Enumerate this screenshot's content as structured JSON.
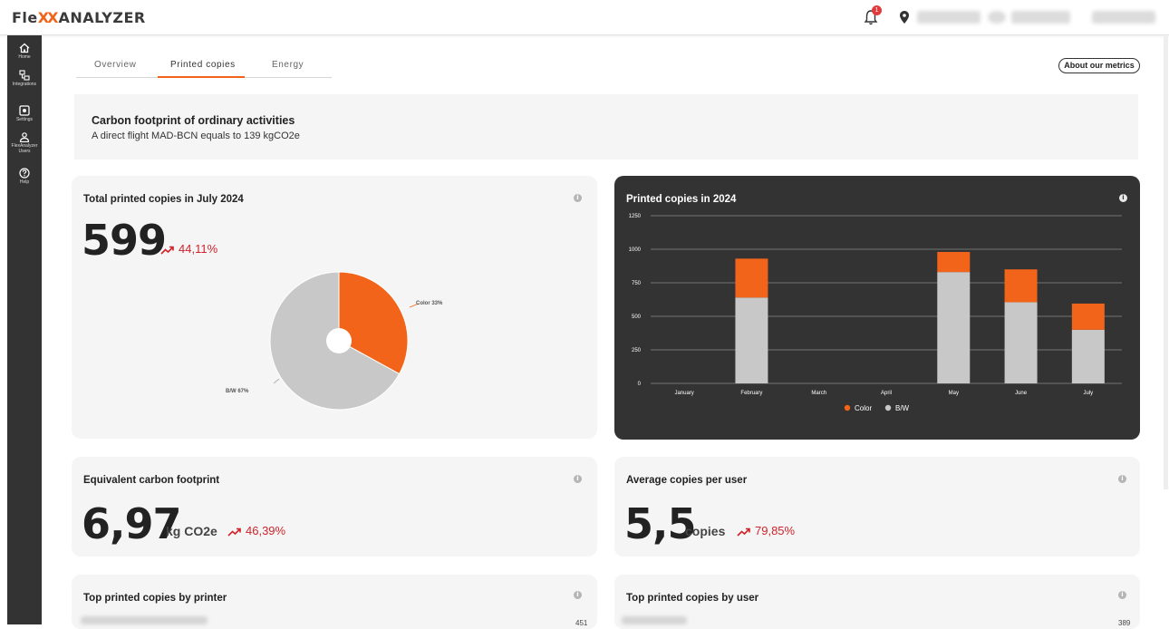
{
  "app": {
    "logo_prefix": "Fle",
    "logo_xx": "XX",
    "logo_suffix": "ANALYZER",
    "notification_count": "1"
  },
  "sidebar": {
    "items": [
      {
        "label": "Home",
        "icon": "home-icon"
      },
      {
        "label": "Integrations",
        "icon": "integrations-icon"
      },
      {
        "label": "Settings",
        "icon": "settings-icon"
      },
      {
        "label": "FlexAnalyzer Users",
        "icon": "users-icon"
      },
      {
        "label": "Help",
        "icon": "help-icon"
      }
    ]
  },
  "tabs": {
    "items": [
      "Overview",
      "Printed copies",
      "Energy"
    ],
    "active": "Printed copies"
  },
  "about_button": "About our metrics",
  "banner": {
    "title": "Carbon footprint of ordinary activities",
    "subtitle": "A direct flight MAD-BCN equals to 139 kgCO2e"
  },
  "total_card": {
    "title": "Total printed copies in July 2024",
    "value": "599",
    "trend": "44,11%",
    "pie": {
      "slices": [
        {
          "name": "Color",
          "percent": 33,
          "color": "#f26419",
          "label": "Color 33%"
        },
        {
          "name": "B/W",
          "percent": 67,
          "color": "#c8c8c8",
          "label": "B/W 67%"
        }
      ]
    }
  },
  "chart_card": {
    "title": "Printed copies in 2024"
  },
  "chart_data": {
    "type": "bar",
    "stacked": true,
    "categories": [
      "January",
      "February",
      "March",
      "April",
      "May",
      "June",
      "July"
    ],
    "series": [
      {
        "name": "B/W",
        "color": "#c8c8c8",
        "values": [
          0,
          640,
          0,
          0,
          830,
          605,
          400
        ]
      },
      {
        "name": "Color",
        "color": "#f26419",
        "values": [
          0,
          290,
          0,
          0,
          150,
          245,
          195
        ]
      }
    ],
    "ylim": [
      0,
      1250
    ],
    "yticks": [
      0,
      250,
      500,
      750,
      1000,
      1250
    ],
    "legend": [
      "Color",
      "B/W"
    ],
    "legend_position": "bottom",
    "grid": true
  },
  "carbon_card": {
    "title": "Equivalent carbon footprint",
    "value": "6,97",
    "unit": "kg CO2e",
    "trend": "46,39%"
  },
  "average_card": {
    "title": "Average copies per user",
    "value": "5,5",
    "unit": "copies",
    "trend": "79,85%"
  },
  "printer_card": {
    "title": "Top printed copies by printer",
    "first_value": "451"
  },
  "user_card": {
    "title": "Top printed copies by user",
    "first_value": "389"
  }
}
